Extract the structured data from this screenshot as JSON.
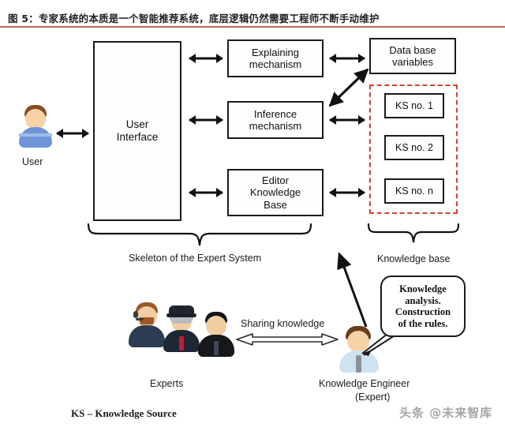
{
  "figure": {
    "title": "图 5：专家系统的本质是一个智能推荐系统，底层逻辑仍然需要工程师不断手动维护",
    "rule_color": "#b3512f"
  },
  "diagram": {
    "boxes": {
      "user_interface": "User\nInterface",
      "explaining_mechanism": "Explaining\nmechanism",
      "inference_mechanism": "Inference\nmechanism",
      "editor_knowledge_base": "Editor\nKnowledge\nBase",
      "database_variables": "Data base\nvariables",
      "ks_1": "KS no. 1",
      "ks_2": "KS no. 2",
      "ks_n": "KS no. n"
    },
    "knowledge_base_border_color": "#e0402c",
    "captions": {
      "skeleton": "Skeleton of the Expert System",
      "knowledge_base": "Knowledge base"
    },
    "actors": {
      "user": "User",
      "experts": "Experts",
      "knowledge_engineer_line1": "Knowledge Engineer",
      "knowledge_engineer_line2": "(Expert)"
    },
    "sharing_label": "Sharing knowledge",
    "bubble_text": "Knowledge\nanalysis.\nConstruction\nof the rules.",
    "legend": "KS – Knowledge Source"
  },
  "watermark": {
    "text": "头条 @未来智库"
  }
}
